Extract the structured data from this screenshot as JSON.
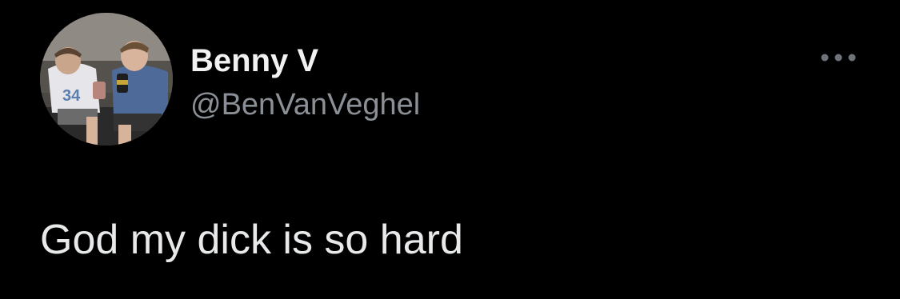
{
  "tweet": {
    "author": {
      "display_name": "Benny V",
      "handle": "@BenVanVeghel",
      "avatar_icon": "profile-photo"
    },
    "text": "God my dick is so hard",
    "more_icon": "ellipsis-icon"
  },
  "colors": {
    "background": "#000000",
    "primary_text": "#e7e9ea",
    "secondary_text": "#8b9096"
  }
}
